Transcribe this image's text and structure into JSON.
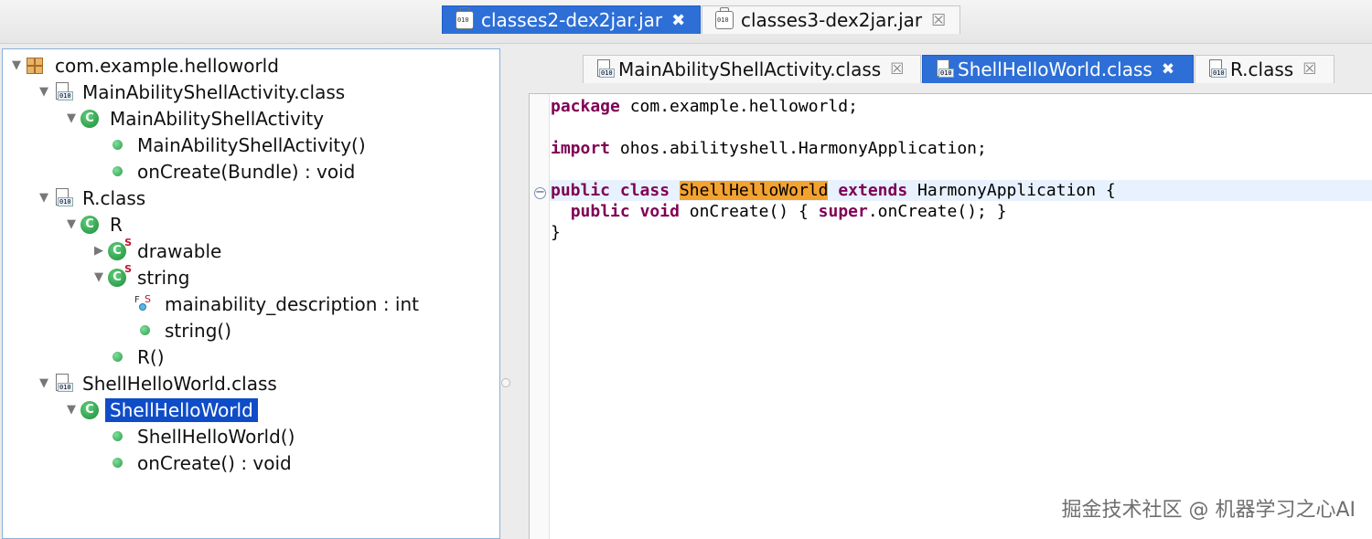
{
  "jar_tabs": [
    {
      "label": "classes2-dex2jar.jar",
      "active": true,
      "close": "✖"
    },
    {
      "label": "classes3-dex2jar.jar",
      "active": false,
      "close": "☒"
    }
  ],
  "tree": [
    {
      "label": "com.example.helloworld",
      "icon": "package-icon",
      "expanded": true
    },
    {
      "label": "MainAbilityShellActivity.class",
      "icon": "class-file-icon",
      "expanded": true
    },
    {
      "label": "MainAbilityShellActivity",
      "icon": "class-icon",
      "expanded": true
    },
    {
      "label": "MainAbilityShellActivity()",
      "icon": "public-method-icon"
    },
    {
      "label": "onCreate(Bundle) : void",
      "icon": "public-method-icon"
    },
    {
      "label": "R.class",
      "icon": "class-file-icon",
      "expanded": true
    },
    {
      "label": "R",
      "icon": "class-icon",
      "expanded": true
    },
    {
      "label": "drawable",
      "icon": "static-final-class-icon",
      "expanded": false
    },
    {
      "label": "string",
      "icon": "static-final-class-icon",
      "expanded": true
    },
    {
      "label": "mainability_description : int",
      "icon": "static-final-field-icon"
    },
    {
      "label": "string()",
      "icon": "public-method-icon"
    },
    {
      "label": "R()",
      "icon": "public-method-icon"
    },
    {
      "label": "ShellHelloWorld.class",
      "icon": "class-file-icon",
      "expanded": true
    },
    {
      "label": "ShellHelloWorld",
      "icon": "class-icon",
      "expanded": true,
      "selected": true
    },
    {
      "label": "ShellHelloWorld()",
      "icon": "public-method-icon"
    },
    {
      "label": "onCreate() : void",
      "icon": "public-method-icon"
    }
  ],
  "editor_tabs": [
    {
      "label": "MainAbilityShellActivity.class",
      "active": false,
      "close": "☒"
    },
    {
      "label": "ShellHelloWorld.class",
      "active": true,
      "close": "✖"
    },
    {
      "label": "R.class",
      "active": false,
      "close": "☒"
    }
  ],
  "code": {
    "line1": {
      "kw": "package",
      "rest": " com.example.helloworld;"
    },
    "line3": {
      "kw": "import",
      "rest": " ohos.abilityshell.HarmonyApplication;"
    },
    "line5": {
      "kw1": "public",
      "kw2": "class",
      "name": "ShellHelloWorld",
      "kw3": "extends",
      "rest": " HarmonyApplication {"
    },
    "line6": {
      "kw1": "public",
      "kw2": "void",
      "mid": " onCreate() { ",
      "kw3": "super",
      "rest": ".onCreate(); }"
    },
    "line7": {
      "text": "}"
    }
  },
  "watermark": "掘金技术社区 @ 机器学习之心AI"
}
